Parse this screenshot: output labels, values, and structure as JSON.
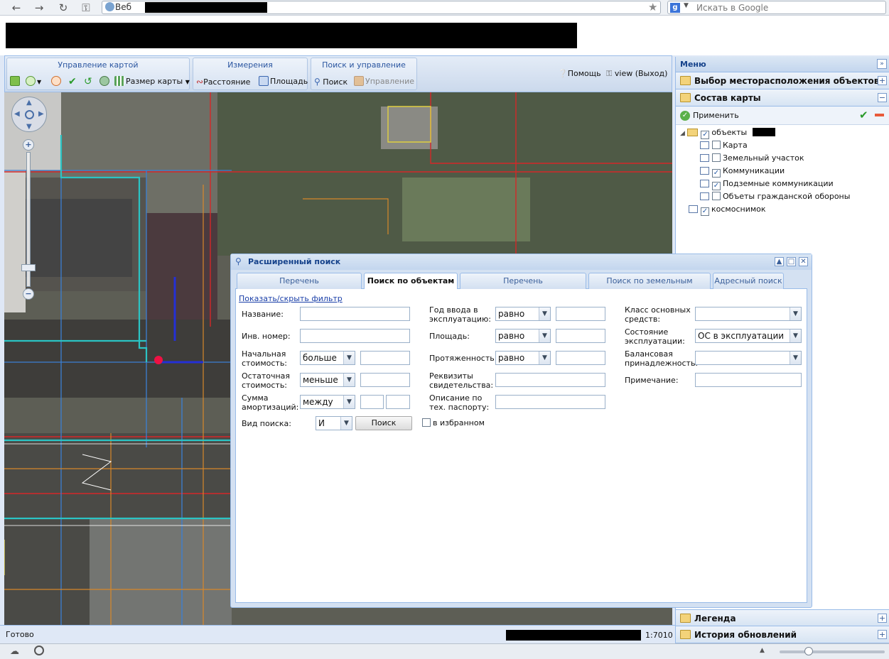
{
  "browser": {
    "address_label": "Веб",
    "search_placeholder": "Искать в Google",
    "search_engine_letter": "g"
  },
  "toolbar": {
    "group_map": "Управление картой",
    "group_measure": "Измерения",
    "group_search": "Поиск и управление",
    "map_size": "Размер карты",
    "distance": "Расстояние",
    "area": "Площадь",
    "search": "Поиск",
    "manage": "Управление",
    "help": "Помощь",
    "logout": "view (Выход)"
  },
  "panel": {
    "title": "Меню",
    "sections": {
      "location": "Выбор месторасположения объектов",
      "composition": "Состав карты",
      "apply": "Применить",
      "legend": "Легенда",
      "history": "История обновлений"
    },
    "tree": [
      {
        "label": "объекты",
        "checked": true,
        "level": 0
      },
      {
        "label": "Карта",
        "checked": false,
        "level": 1
      },
      {
        "label": "Земельный участок",
        "checked": false,
        "level": 1
      },
      {
        "label": "Коммуникации",
        "checked": true,
        "level": 1
      },
      {
        "label": "Подземные коммуникации",
        "checked": true,
        "level": 1
      },
      {
        "label": "Объеты гражданской обороны",
        "checked": false,
        "level": 1
      },
      {
        "label": "космоснимок",
        "checked": true,
        "level": 0
      }
    ]
  },
  "dialog": {
    "title": "Расширенный поиск",
    "tabs": [
      "Перечень балансодержателей",
      "Поиск по объектам",
      "Перечень землепользователей",
      "Поиск по земельным участкам",
      "Адресный поиск"
    ],
    "active_tab": 1,
    "filter_link": "Показать/скрыть фильтр",
    "col1": {
      "name": "Название:",
      "inv": "Инв. номер:",
      "start_cost_1": "Начальная",
      "start_cost_2": "стоимость:",
      "start_cost_op": "больше",
      "residual_1": "Остаточная",
      "residual_2": "стоимость:",
      "residual_op": "меньше",
      "amort_1": "Сумма",
      "amort_2": "амортизаций:",
      "amort_op": "между",
      "search_type": "Вид поиска:",
      "search_type_val": "И",
      "search_button": "Поиск"
    },
    "col2": {
      "year_1": "Год ввода в",
      "year_2": "эксплуатацию:",
      "year_op": "равно",
      "area": "Площадь:",
      "area_op": "равно",
      "length": "Протяженность:",
      "length_op": "равно",
      "req_1": "Реквизиты",
      "req_2": "свидетельства:",
      "desc_1": "Описание по",
      "desc_2": "тех. паспорту:",
      "favorites": "в избранном"
    },
    "col3": {
      "class_1": "Класс основных",
      "class_2": "средств:",
      "state_1": "Состояние",
      "state_2": "эксплуатации:",
      "state_val": "ОС в эксплуатации",
      "bal_1": "Балансовая",
      "bal_2": "принадлежность:",
      "note": "Примечание:"
    }
  },
  "status": {
    "ready": "Готово",
    "scale": "1:7010"
  }
}
